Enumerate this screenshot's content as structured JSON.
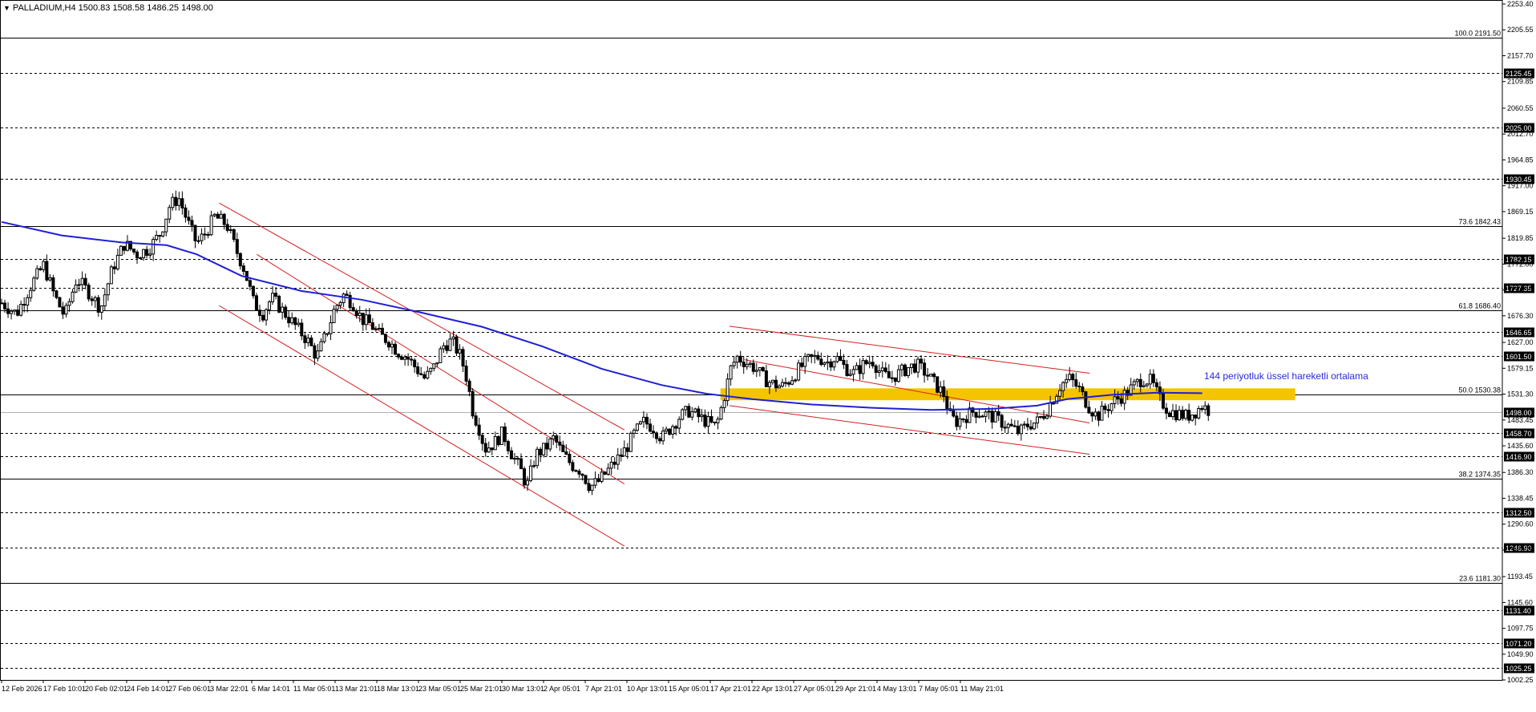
{
  "header": {
    "symbol_line": "PALLADIUM,H4",
    "ohlc": "1500.83 1508.58 1486.25 1498.00"
  },
  "annotation": {
    "ema_label": "144 periyotluk üssel hareketli ortalama"
  },
  "colors": {
    "background": "#ffffff",
    "candle": "#000000",
    "ema": "#1f1fd6",
    "channel": "#d42020",
    "zone": "#f5c400",
    "annotation": "#2a2ae0",
    "label_box": "#000000"
  },
  "chart_data": {
    "type": "candlestick",
    "symbol": "PALLADIUM",
    "timeframe": "H4",
    "ylim": [
      1002.25,
      2253.4
    ],
    "y_ticks": [
      "2253.40",
      "2205.55",
      "2157.70",
      "2109.85",
      "2060.55",
      "2012.70",
      "1964.85",
      "1917.00",
      "1869.15",
      "1819.85",
      "1772.00",
      "1724.15",
      "1676.30",
      "1627.00",
      "1579.15",
      "1531.30",
      "1483.45",
      "1435.60",
      "1386.30",
      "1338.45",
      "1290.60",
      "1242.75",
      "1193.45",
      "1145.60",
      "1097.75",
      "1049.90",
      "1002.25"
    ],
    "x_ticks": [
      "12 Feb 2026",
      "17 Feb 10:01",
      "20 Feb 02:01",
      "24 Feb 14:01",
      "27 Feb 06:01",
      "3 Mar 22:01",
      "6 Mar 14:01",
      "11 Mar 05:01",
      "13 Mar 21:01",
      "18 Mar 13:01",
      "23 Mar 05:01",
      "25 Mar 21:01",
      "30 Mar 13:01",
      "2 Apr 05:01",
      "7 Apr 21:01",
      "10 Apr 13:01",
      "15 Apr 05:01",
      "17 Apr 21:01",
      "22 Apr 13:01",
      "27 Apr 05:01",
      "29 Apr 21:01",
      "4 May 13:01",
      "7 May 05:01",
      "11 May 21:01"
    ],
    "horizontal_levels": [
      {
        "value": 2125.45,
        "label": "2125.45",
        "style": "dashed",
        "boxed": true
      },
      {
        "value": 2025.0,
        "label": "2025.00",
        "style": "dashed",
        "boxed": true
      },
      {
        "value": 1930.45,
        "label": "1930.45",
        "style": "dashed",
        "boxed": true
      },
      {
        "value": 1782.15,
        "label": "1782.15",
        "style": "dashed",
        "boxed": true
      },
      {
        "value": 1727.35,
        "label": "1727.35",
        "style": "dashed",
        "boxed": true
      },
      {
        "value": 1646.65,
        "label": "1646.65",
        "style": "dashed",
        "boxed": true
      },
      {
        "value": 1601.5,
        "label": "1601.50",
        "style": "dashed",
        "boxed": true
      },
      {
        "value": 1498.0,
        "label": "1498.00",
        "style": "current",
        "boxed": true
      },
      {
        "value": 1458.7,
        "label": "1458.70",
        "style": "dashed",
        "boxed": true
      },
      {
        "value": 1416.9,
        "label": "1416.90",
        "style": "dashed",
        "boxed": true
      },
      {
        "value": 1312.5,
        "label": "1312.50",
        "style": "dashed",
        "boxed": true
      },
      {
        "value": 1246.9,
        "label": "1246.90",
        "style": "dashed",
        "boxed": true
      },
      {
        "value": 1131.4,
        "label": "1131.40",
        "style": "dashed",
        "boxed": true
      },
      {
        "value": 1071.2,
        "label": "1071.20",
        "style": "dashed",
        "boxed": true
      },
      {
        "value": 1025.25,
        "label": "1025.25",
        "style": "dashed",
        "boxed": true
      }
    ],
    "fibonacci": [
      {
        "value": 2191.5,
        "label": "100.0 2191.50"
      },
      {
        "value": 1842.43,
        "label": "73.6 1842.43"
      },
      {
        "value": 1686.4,
        "label": "61.8 1686.40"
      },
      {
        "value": 1530.38,
        "label": "50.0 1530.38"
      },
      {
        "value": 1374.35,
        "label": "38.2 1374.35"
      },
      {
        "value": 1181.3,
        "label": "23.6 1181.30"
      }
    ],
    "zone": {
      "from_index": 0.479,
      "to_index": 0.862,
      "low": 1520.0,
      "high": 1542.0
    },
    "price_path": [
      [
        0.0,
        1700
      ],
      [
        0.01,
        1680
      ],
      [
        0.02,
        1735
      ],
      [
        0.028,
        1770
      ],
      [
        0.035,
        1715
      ],
      [
        0.042,
        1675
      ],
      [
        0.05,
        1745
      ],
      [
        0.058,
        1720
      ],
      [
        0.066,
        1690
      ],
      [
        0.074,
        1765
      ],
      [
        0.082,
        1810
      ],
      [
        0.09,
        1790
      ],
      [
        0.098,
        1800
      ],
      [
        0.106,
        1830
      ],
      [
        0.112,
        1880
      ],
      [
        0.118,
        1895
      ],
      [
        0.124,
        1850
      ],
      [
        0.13,
        1810
      ],
      [
        0.136,
        1830
      ],
      [
        0.142,
        1860
      ],
      [
        0.15,
        1845
      ],
      [
        0.156,
        1800
      ],
      [
        0.162,
        1760
      ],
      [
        0.168,
        1700
      ],
      [
        0.174,
        1680
      ],
      [
        0.18,
        1710
      ],
      [
        0.186,
        1690
      ],
      [
        0.192,
        1670
      ],
      [
        0.198,
        1650
      ],
      [
        0.204,
        1630
      ],
      [
        0.21,
        1600
      ],
      [
        0.216,
        1640
      ],
      [
        0.222,
        1690
      ],
      [
        0.228,
        1715
      ],
      [
        0.234,
        1700
      ],
      [
        0.24,
        1670
      ],
      [
        0.246,
        1660
      ],
      [
        0.252,
        1640
      ],
      [
        0.258,
        1630
      ],
      [
        0.264,
        1610
      ],
      [
        0.27,
        1600
      ],
      [
        0.276,
        1580
      ],
      [
        0.282,
        1560
      ],
      [
        0.288,
        1580
      ],
      [
        0.294,
        1620
      ],
      [
        0.3,
        1630
      ],
      [
        0.306,
        1600
      ],
      [
        0.31,
        1560
      ],
      [
        0.314,
        1500
      ],
      [
        0.318,
        1470
      ],
      [
        0.322,
        1430
      ],
      [
        0.328,
        1440
      ],
      [
        0.334,
        1460
      ],
      [
        0.34,
        1420
      ],
      [
        0.346,
        1390
      ],
      [
        0.35,
        1360
      ],
      [
        0.356,
        1420
      ],
      [
        0.362,
        1430
      ],
      [
        0.368,
        1450
      ],
      [
        0.374,
        1420
      ],
      [
        0.38,
        1400
      ],
      [
        0.386,
        1390
      ],
      [
        0.392,
        1360
      ],
      [
        0.398,
        1370
      ],
      [
        0.404,
        1390
      ],
      [
        0.41,
        1410
      ],
      [
        0.416,
        1430
      ],
      [
        0.422,
        1460
      ],
      [
        0.428,
        1480
      ],
      [
        0.434,
        1470
      ],
      [
        0.44,
        1450
      ],
      [
        0.446,
        1470
      ],
      [
        0.452,
        1490
      ],
      [
        0.458,
        1500
      ],
      [
        0.464,
        1490
      ],
      [
        0.47,
        1480
      ],
      [
        0.476,
        1470
      ],
      [
        0.48,
        1510
      ],
      [
        0.486,
        1580
      ],
      [
        0.49,
        1600
      ],
      [
        0.496,
        1590
      ],
      [
        0.502,
        1580
      ],
      [
        0.508,
        1560
      ],
      [
        0.514,
        1550
      ],
      [
        0.52,
        1545
      ],
      [
        0.526,
        1560
      ],
      [
        0.532,
        1580
      ],
      [
        0.538,
        1595
      ],
      [
        0.544,
        1600
      ],
      [
        0.55,
        1590
      ],
      [
        0.556,
        1600
      ],
      [
        0.562,
        1580
      ],
      [
        0.568,
        1570
      ],
      [
        0.574,
        1585
      ],
      [
        0.58,
        1595
      ],
      [
        0.586,
        1570
      ],
      [
        0.592,
        1560
      ],
      [
        0.598,
        1570
      ],
      [
        0.604,
        1580
      ],
      [
        0.61,
        1585
      ],
      [
        0.616,
        1570
      ],
      [
        0.622,
        1550
      ],
      [
        0.628,
        1530
      ],
      [
        0.632,
        1490
      ],
      [
        0.636,
        1480
      ],
      [
        0.642,
        1490
      ],
      [
        0.648,
        1500
      ],
      [
        0.654,
        1495
      ],
      [
        0.66,
        1490
      ],
      [
        0.666,
        1480
      ],
      [
        0.672,
        1470
      ],
      [
        0.678,
        1460
      ],
      [
        0.684,
        1475
      ],
      [
        0.69,
        1480
      ],
      [
        0.696,
        1500
      ],
      [
        0.7,
        1520
      ],
      [
        0.706,
        1550
      ],
      [
        0.712,
        1560
      ],
      [
        0.718,
        1540
      ],
      [
        0.724,
        1510
      ],
      [
        0.73,
        1490
      ],
      [
        0.736,
        1505
      ],
      [
        0.742,
        1520
      ],
      [
        0.748,
        1530
      ],
      [
        0.754,
        1545
      ],
      [
        0.76,
        1560
      ],
      [
        0.766,
        1555
      ],
      [
        0.772,
        1520
      ],
      [
        0.778,
        1500
      ],
      [
        0.784,
        1495
      ],
      [
        0.79,
        1490
      ],
      [
        0.796,
        1500
      ],
      [
        0.8,
        1510
      ],
      [
        0.806,
        1498
      ]
    ],
    "ema_path": [
      [
        0.0,
        1850
      ],
      [
        0.04,
        1825
      ],
      [
        0.08,
        1812
      ],
      [
        0.11,
        1807
      ],
      [
        0.13,
        1790
      ],
      [
        0.16,
        1750
      ],
      [
        0.2,
        1722
      ],
      [
        0.24,
        1706
      ],
      [
        0.28,
        1682
      ],
      [
        0.32,
        1656
      ],
      [
        0.36,
        1620
      ],
      [
        0.4,
        1578
      ],
      [
        0.44,
        1548
      ],
      [
        0.47,
        1532
      ],
      [
        0.5,
        1522
      ],
      [
        0.54,
        1512
      ],
      [
        0.58,
        1506
      ],
      [
        0.62,
        1502
      ],
      [
        0.66,
        1504
      ],
      [
        0.69,
        1510
      ],
      [
        0.71,
        1522
      ],
      [
        0.74,
        1530
      ],
      [
        0.77,
        1534
      ],
      [
        0.8,
        1533
      ]
    ],
    "channels": [
      {
        "x1": 0.145,
        "y1": 1885,
        "x2": 0.415,
        "y2": 1465
      },
      {
        "x1": 0.145,
        "y1": 1695,
        "x2": 0.415,
        "y2": 1250
      },
      {
        "x1": 0.17,
        "y1": 1790,
        "x2": 0.415,
        "y2": 1365
      },
      {
        "x1": 0.485,
        "y1": 1657,
        "x2": 0.725,
        "y2": 1570
      },
      {
        "x1": 0.485,
        "y1": 1510,
        "x2": 0.725,
        "y2": 1420
      },
      {
        "x1": 0.495,
        "y1": 1595,
        "x2": 0.725,
        "y2": 1478
      }
    ]
  }
}
